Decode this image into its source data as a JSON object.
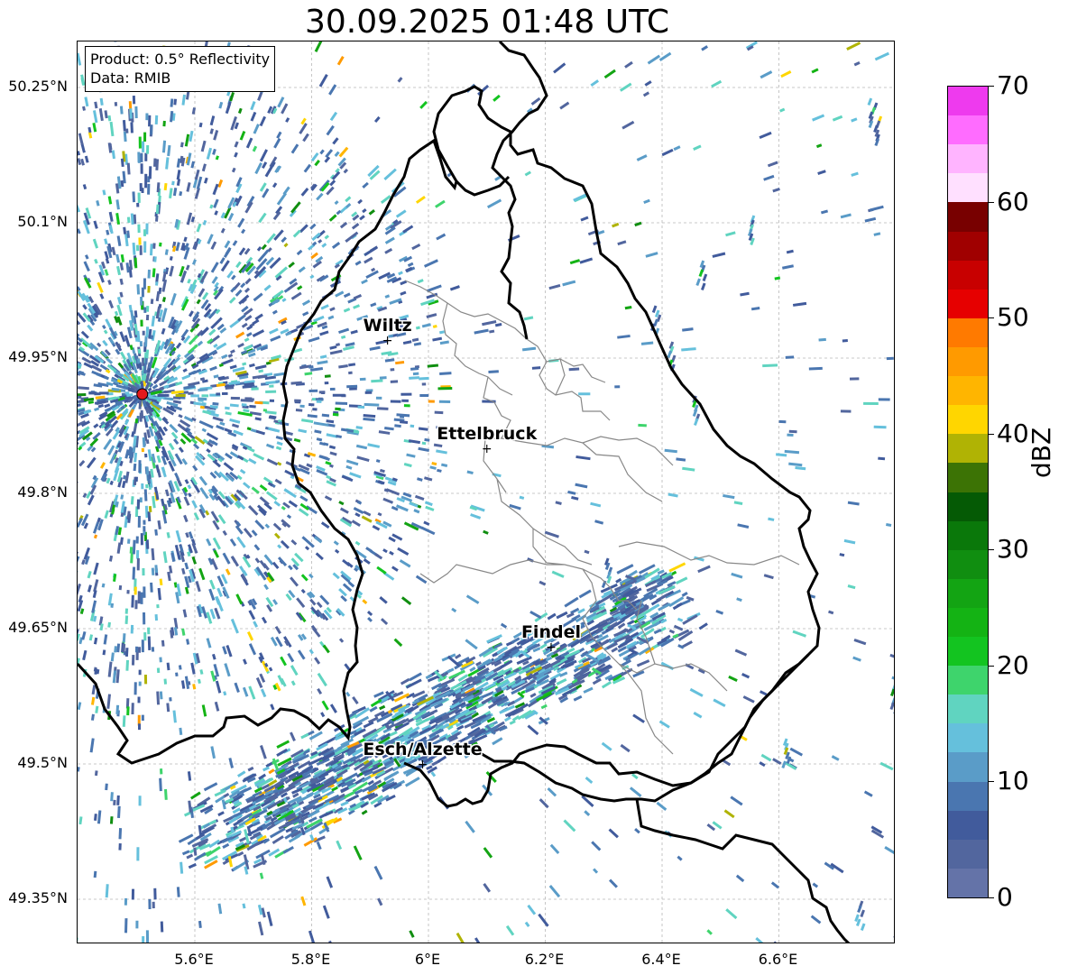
{
  "title": "30.09.2025 01:48 UTC",
  "info": {
    "product": "Product: 0.5° Reflectivity",
    "data": "Data: RMIB"
  },
  "map": {
    "lon_range": [
      5.42,
      6.82
    ],
    "lat_range": [
      49.3,
      50.3
    ],
    "lat_ticks": [
      "50.25°N",
      "50.1°N",
      "49.95°N",
      "49.8°N",
      "49.65°N",
      "49.5°N",
      "49.35°N"
    ],
    "lon_ticks": [
      "5.6°E",
      "5.8°E",
      "6°E",
      "6.2°E",
      "6.4°E",
      "6.6°E"
    ],
    "grid": true,
    "radar_site": {
      "lon": 5.51,
      "lat": 49.91,
      "color": "#e41a1c"
    },
    "cities": [
      {
        "name": "Wiltz",
        "lon": 5.93,
        "lat": 49.97
      },
      {
        "name": "Ettelbruck",
        "lon": 6.1,
        "lat": 49.85
      },
      {
        "name": "Findel",
        "lon": 6.21,
        "lat": 49.63
      },
      {
        "name": "Esch/Alzette",
        "lon": 5.99,
        "lat": 49.5
      }
    ]
  },
  "colorbar": {
    "label": "dBZ",
    "tick_labels": [
      "70",
      "60",
      "50",
      "40",
      "30",
      "20",
      "10",
      "0"
    ],
    "min": 0,
    "max": 70,
    "colors": [
      "#6473a8",
      "#52669e",
      "#415b9c",
      "#4a76b0",
      "#5a9cc8",
      "#65c0dc",
      "#60d4c0",
      "#3ed46c",
      "#13c420",
      "#14b314",
      "#13a413",
      "#108e10",
      "#0a780a",
      "#055a05",
      "#3c7305",
      "#b0b304",
      "#ffd600",
      "#ffb500",
      "#ff9a00",
      "#ff7a00",
      "#e60000",
      "#c80000",
      "#a00000",
      "#780000",
      "#ffe0ff",
      "#ffb4ff",
      "#ff6cff",
      "#ee3aee"
    ]
  }
}
